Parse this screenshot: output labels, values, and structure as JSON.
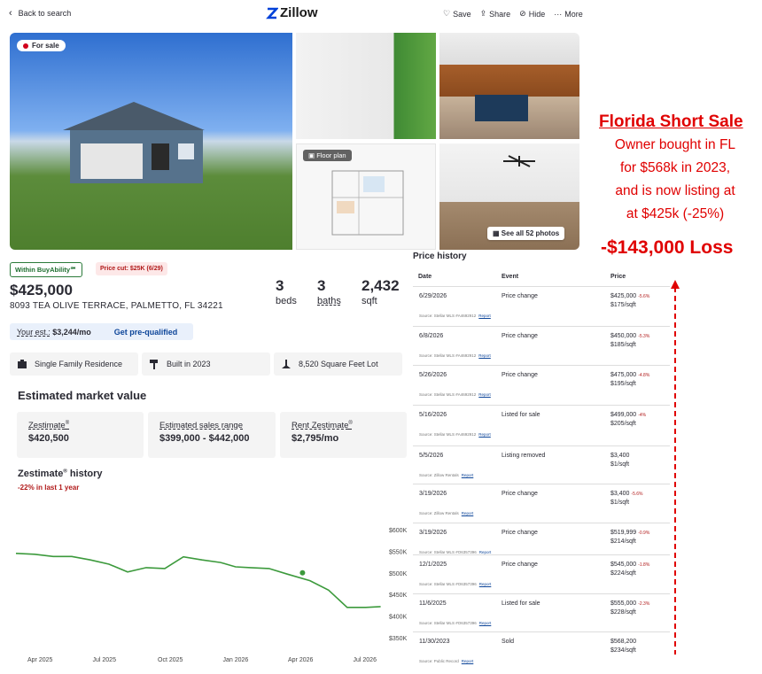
{
  "header": {
    "back_label": "Back to search",
    "logo_text": "Zillow",
    "actions": {
      "save": "Save",
      "share": "Share",
      "hide": "Hide",
      "more": "More"
    }
  },
  "photos": {
    "status_badge": "For sale",
    "floor_plan_label": "Floor plan",
    "see_all_label": "See all 52 photos"
  },
  "listing": {
    "buyability": "Within BuyAbility℠",
    "price_cut": "Price cut: $25K (6/29)",
    "price": "$425,000",
    "address": "8093 TEA OLIVE TERRACE, PALMETTO, FL 34221",
    "beds": "3",
    "beds_label": "beds",
    "baths": "3",
    "baths_label": "baths",
    "sqft": "2,432",
    "sqft_label": "sqft",
    "your_est_label": "Your est.:",
    "your_est_value": "$3,244/mo",
    "prequal_label": "Get pre-qualified",
    "facts": [
      "Single Family Residence",
      "Built in 2023",
      "8,520 Square Feet Lot"
    ]
  },
  "market_value": {
    "title": "Estimated market value",
    "zestimate_label": "Zestimate",
    "zestimate_reg": "®",
    "zestimate_value": "$420,500",
    "range_label": "Estimated sales range",
    "range_value": "$399,000 - $442,000",
    "rent_label": "Rent Zestimate",
    "rent_reg": "®",
    "rent_value": "$2,795/mo"
  },
  "zestimate_history": {
    "title": "Zestimate",
    "title_reg": "®",
    "title_suffix": " history",
    "change": "-22% in last 1 year"
  },
  "chart_data": {
    "type": "line",
    "x_ticks": [
      "Apr 2025",
      "Jul 2025",
      "Oct 2025",
      "Jan 2026",
      "Apr 2026",
      "Jul 2026"
    ],
    "y_ticks": [
      "$600K",
      "$550K",
      "$500K",
      "$450K",
      "$400K",
      "$350K"
    ],
    "ylim": [
      350000,
      600000
    ],
    "series": [
      {
        "color": "#3c9a3c",
        "x": [
          0,
          0.5,
          1,
          1.5,
          2,
          2.5,
          3,
          3.5,
          4,
          4.5,
          5,
          5.5,
          5.9,
          6.3,
          6.8,
          7.3,
          7.9,
          8.4,
          8.9,
          9.4,
          9.8
        ],
        "y": [
          545000,
          543000,
          538000,
          538000,
          530000,
          520000,
          502000,
          512000,
          510000,
          537000,
          530000,
          524000,
          514000,
          512000,
          510000,
          497000,
          482000,
          460000,
          420000,
          420000,
          422000
        ]
      }
    ],
    "marker_x": 7.7,
    "marker_y": 500000,
    "grid": false
  },
  "price_history": {
    "title": "Price history",
    "columns": [
      "Date",
      "Event",
      "Price"
    ],
    "report_label": "Report",
    "rows": [
      {
        "date": "6/29/2026",
        "event": "Price change",
        "price": "$425,000",
        "pct": "-5.6%",
        "sqft": "$175/sqft",
        "source": "Source: Stellar MLS #A4692912"
      },
      {
        "date": "6/8/2026",
        "event": "Price change",
        "price": "$450,000",
        "pct": "-5.3%",
        "sqft": "$185/sqft",
        "source": "Source: Stellar MLS #A4692912"
      },
      {
        "date": "5/26/2026",
        "event": "Price change",
        "price": "$475,000",
        "pct": "-4.8%",
        "sqft": "$195/sqft",
        "source": "Source: Stellar MLS #A4692912"
      },
      {
        "date": "5/16/2026",
        "event": "Listed for sale",
        "price": "$499,000",
        "pct": "-4%",
        "sqft": "$205/sqft",
        "source": "Source: Stellar MLS #A4692912"
      },
      {
        "date": "5/5/2026",
        "event": "Listing removed",
        "price": "$3,400",
        "pct": "",
        "sqft": "$1/sqft",
        "source": "Source: Zillow Rentals"
      },
      {
        "date": "3/19/2026",
        "event": "Price change",
        "price": "$3,400",
        "pct": "-5.6%",
        "sqft": "$1/sqft",
        "source": "Source: Zillow Rentals"
      },
      {
        "date": "3/19/2026",
        "event": "Price change",
        "price": "$519,999",
        "pct": "-0.9%",
        "sqft": "$214/sqft",
        "source": "Source: Stellar MLS #O6357396"
      },
      {
        "date": "12/1/2025",
        "event": "Price change",
        "price": "$545,000",
        "pct": "-1.8%",
        "sqft": "$224/sqft",
        "source": "Source: Stellar MLS #O6357396"
      },
      {
        "date": "11/6/2025",
        "event": "Listed for sale",
        "price": "$555,000",
        "pct": "-2.3%",
        "sqft": "$228/sqft",
        "source": "Source: Stellar MLS #O6357396"
      },
      {
        "date": "11/30/2023",
        "event": "Sold",
        "price": "$568,200",
        "pct": "",
        "sqft": "$234/sqft",
        "source": "Source: Public Record"
      }
    ]
  },
  "annotation": {
    "title": "Florida Short Sale",
    "line1": "Owner bought in FL",
    "line2": "for $568k in 2023,",
    "line3": "and is now listing at",
    "line4": "at $425k (-25%)",
    "loss": "-$143,000 Loss",
    "color": "#e00000"
  }
}
